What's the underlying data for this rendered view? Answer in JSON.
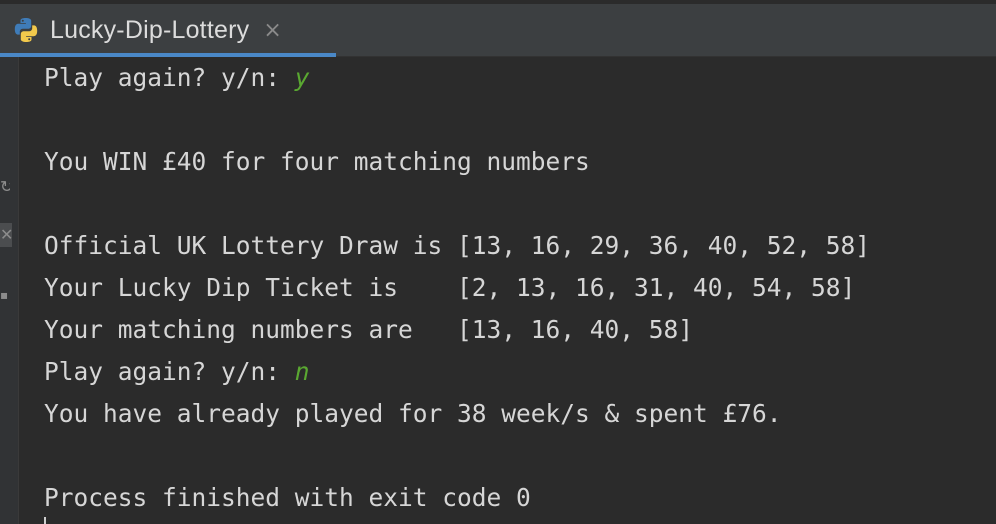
{
  "tab": {
    "title": "Lucky-Dip-Lottery",
    "close_glyph": "×",
    "icon": "python-icon"
  },
  "colors": {
    "background": "#2b2b2b",
    "tab_underline": "#4a88c7",
    "output_text": "#d6d6d6",
    "user_input": "#5aa831"
  },
  "console": {
    "lines": [
      {
        "text": "Play again? y/n: ",
        "input": "y"
      },
      {
        "text": ""
      },
      {
        "text": "You WIN £40 for four matching numbers"
      },
      {
        "text": ""
      },
      {
        "text": "Official UK Lottery Draw is [13, 16, 29, 36, 40, 52, 58]"
      },
      {
        "text": "Your Lucky Dip Ticket is    [2, 13, 16, 31, 40, 54, 58]"
      },
      {
        "text": "Your matching numbers are   [13, 16, 40, 58]"
      },
      {
        "text": "Play again? y/n: ",
        "input": "n"
      },
      {
        "text": "You have already played for 38 week/s & spent £76."
      },
      {
        "text": ""
      },
      {
        "text": "Process finished with exit code 0"
      }
    ]
  }
}
